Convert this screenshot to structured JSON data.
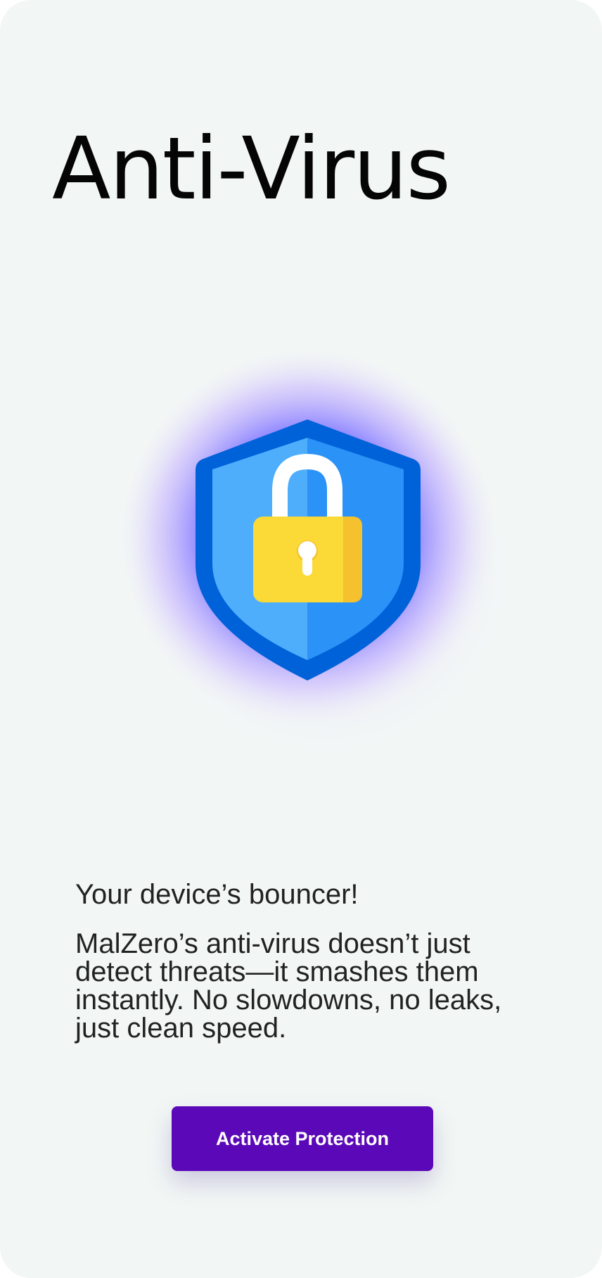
{
  "page": {
    "title": "Anti-Virus"
  },
  "hero": {
    "icon": "shield-lock-icon",
    "colors": {
      "glow_inner": "#7a7aff",
      "glow_outer": "#c9a9ff",
      "shield_border": "#0062d9",
      "shield_left": "#4eaefc",
      "shield_right": "#2b92f8",
      "lock_body": "#fbd937",
      "lock_shackle": "#ffffff"
    }
  },
  "content": {
    "tagline": "Your device’s bouncer!",
    "description": "MalZero’s anti-virus doesn’t just detect threats—it smashes them instantly. No slowdowns, no leaks, just clean speed."
  },
  "cta": {
    "label": "Activate Protection",
    "color": "#5b09b8"
  }
}
